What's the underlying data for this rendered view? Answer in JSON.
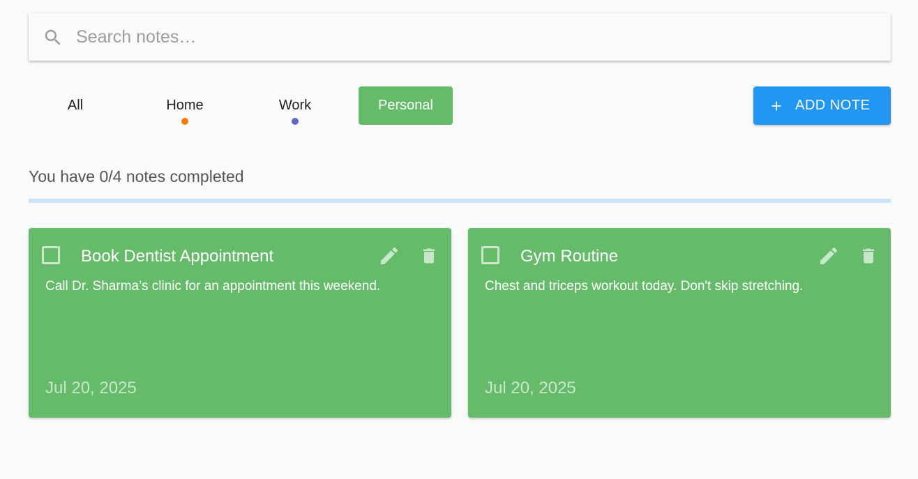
{
  "search": {
    "placeholder": "Search notes…",
    "value": ""
  },
  "tabs": [
    {
      "label": "All",
      "dot_color": null,
      "selected": false
    },
    {
      "label": "Home",
      "dot_color": "#f57c00",
      "selected": false
    },
    {
      "label": "Work",
      "dot_color": "#5c6bc0",
      "selected": false
    },
    {
      "label": "Personal",
      "dot_color": null,
      "selected": true
    }
  ],
  "add_button": {
    "label": "ADD NOTE",
    "icon": "plus-icon",
    "color": "#2196f3"
  },
  "progress": {
    "text": "You have 0/4 notes completed",
    "completed": 0,
    "total": 4
  },
  "colors": {
    "personal": "#66bb6a",
    "accent": "#2196f3",
    "track": "#c9e4fb"
  },
  "notes": [
    {
      "title": "Book Dentist Appointment",
      "body": "Call Dr. Sharma’s clinic for an appointment this weekend.",
      "date": "Jul 20, 2025",
      "completed": false,
      "edit_icon": "pencil-icon",
      "delete_icon": "trash-icon"
    },
    {
      "title": "Gym Routine",
      "body": "Chest and triceps workout today. Don't skip stretching.",
      "date": "Jul 20, 2025",
      "completed": false,
      "edit_icon": "pencil-icon",
      "delete_icon": "trash-icon"
    }
  ]
}
